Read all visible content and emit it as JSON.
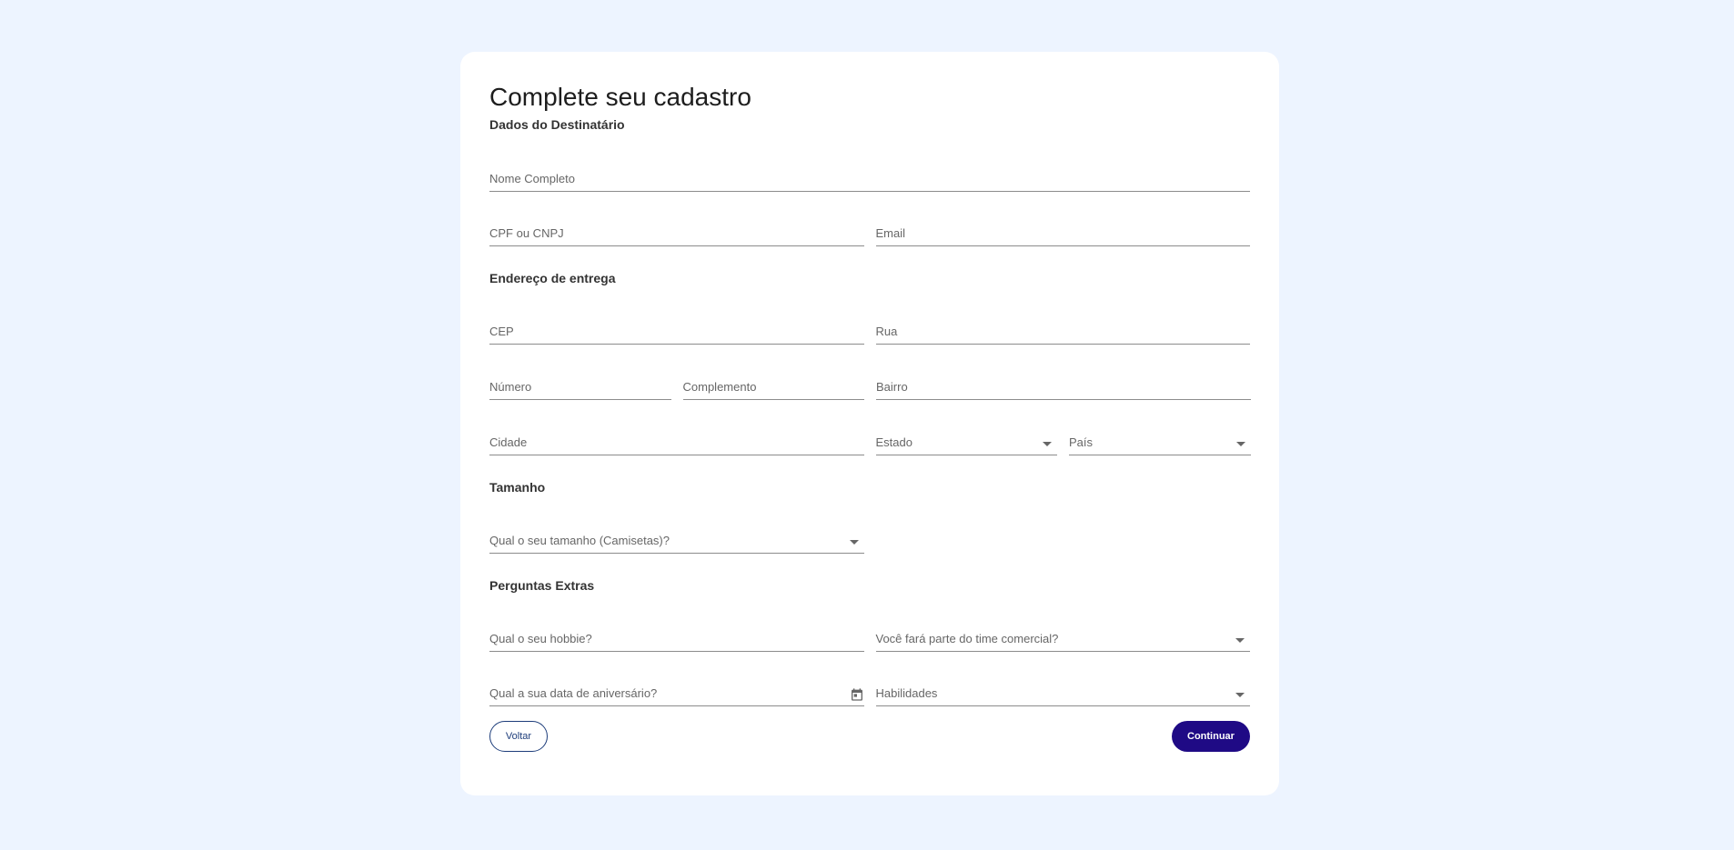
{
  "form": {
    "title": "Complete seu cadastro",
    "sections": {
      "recipient": "Dados do Destinatário",
      "address": "Endereço de entrega",
      "size": "Tamanho",
      "extras": "Perguntas Extras"
    },
    "fields": {
      "full_name": "Nome Completo",
      "cpf_cnpj": "CPF ou CNPJ",
      "email": "Email",
      "cep": "CEP",
      "street": "Rua",
      "number": "Número",
      "complement": "Complemento",
      "neighborhood": "Bairro",
      "city": "Cidade",
      "state": "Estado",
      "country": "País",
      "shirt_size": "Qual o seu tamanho (Camisetas)?",
      "hobby": "Qual o seu hobbie?",
      "sales_team": "Você fará parte do time comercial?",
      "birthday": "Qual a sua data de aniversário?",
      "skills": "Habilidades"
    },
    "buttons": {
      "back": "Voltar",
      "continue": "Continuar"
    }
  },
  "colors": {
    "page_background": "#edf4ff",
    "card_background": "#ffffff",
    "primary_button": "#1f0a85",
    "outline_button": "#1c3c7a"
  },
  "icons": {
    "dropdown": "chevron-down-icon",
    "date_picker": "calendar-icon"
  }
}
